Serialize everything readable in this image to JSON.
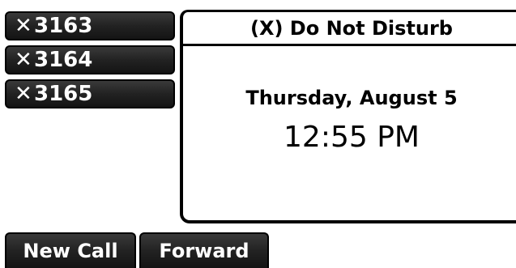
{
  "line_keys": [
    {
      "icon": "x-icon",
      "glyph": "✕",
      "label": "3163"
    },
    {
      "icon": "x-icon",
      "glyph": "✕",
      "label": "3164"
    },
    {
      "icon": "x-icon",
      "glyph": "✕",
      "label": "3165"
    }
  ],
  "status_panel": {
    "title": "(X) Do Not Disturb",
    "date": "Thursday, August 5",
    "time": "12:55 PM"
  },
  "softkeys": [
    {
      "label": "New Call"
    },
    {
      "label": "Forward"
    }
  ]
}
